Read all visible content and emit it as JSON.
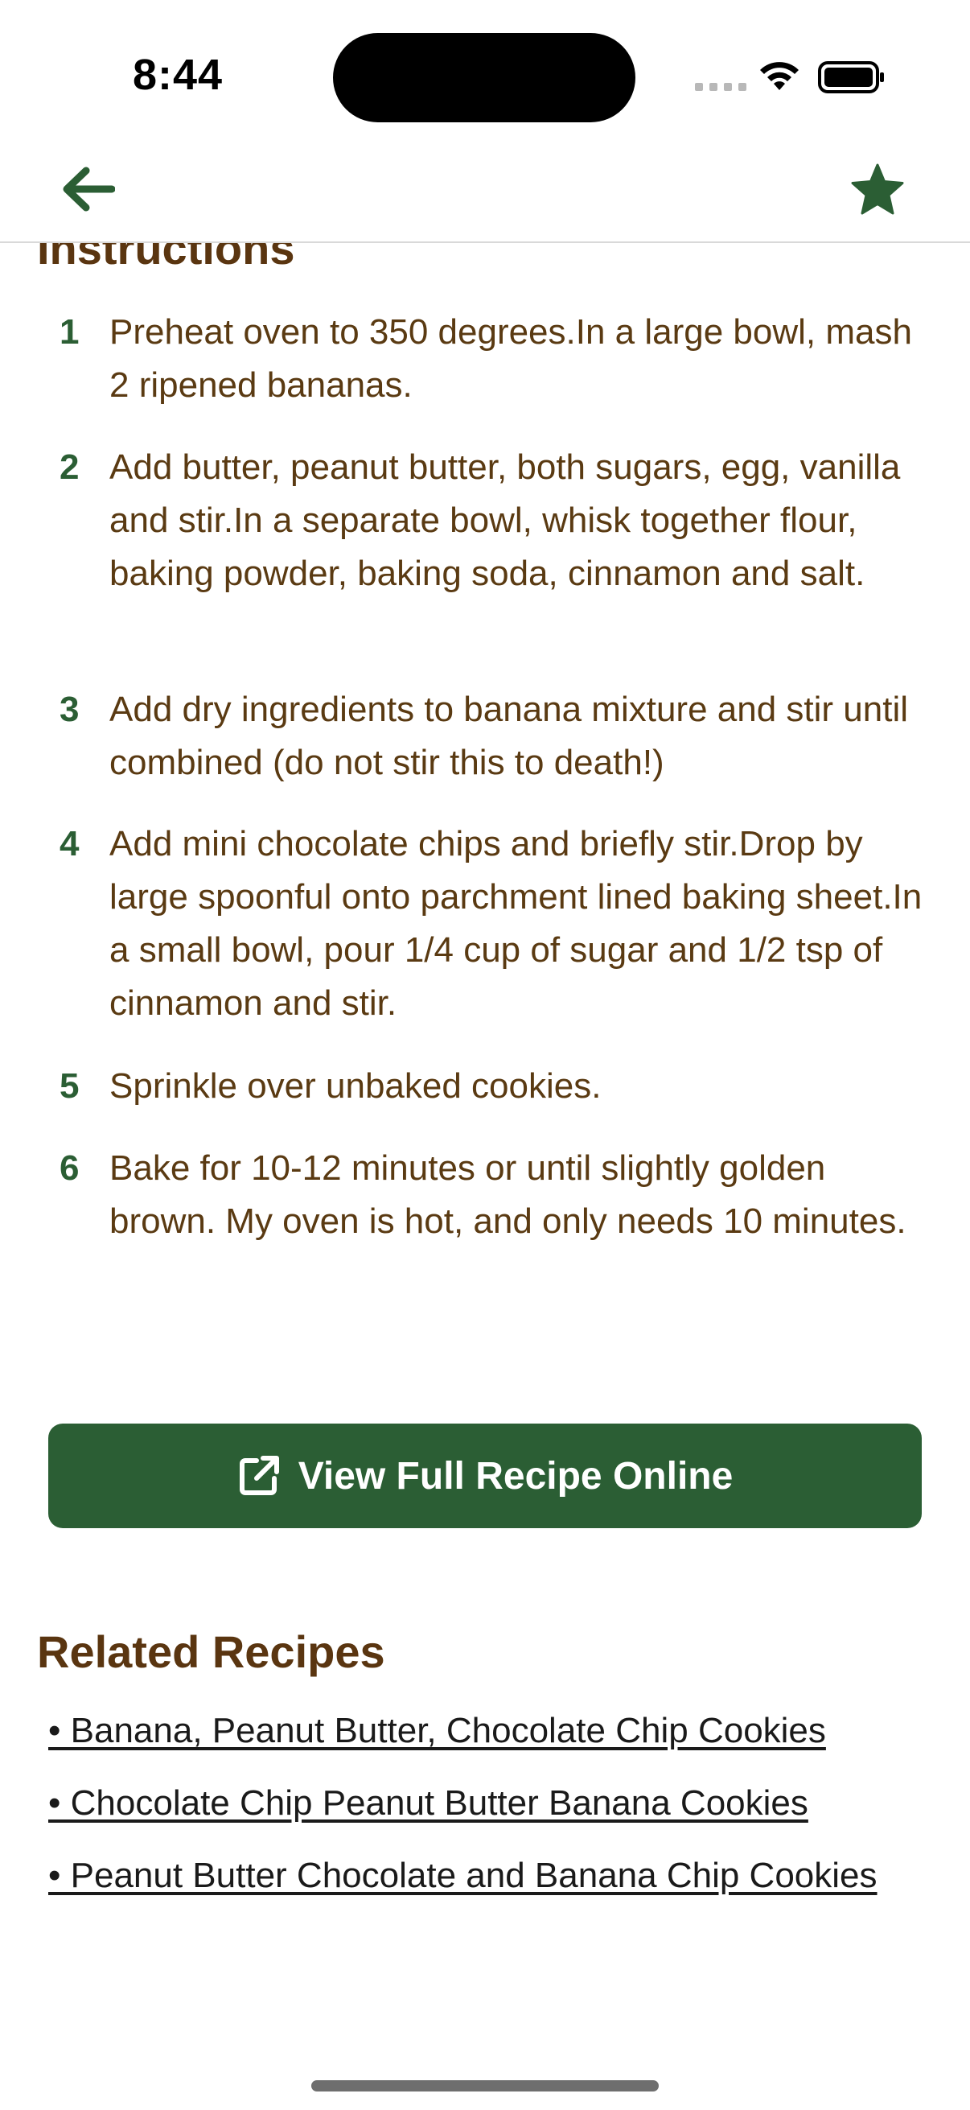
{
  "status_bar": {
    "time": "8:44"
  },
  "nav": {
    "back_icon": "arrow-left-icon",
    "favorite_icon": "star-icon"
  },
  "instructions": {
    "heading": "Instructions",
    "steps": [
      {
        "number": "1",
        "text": "Preheat oven to 350 degrees.In a large bowl, mash 2 ripened bananas."
      },
      {
        "number": "2",
        "text": "Add butter, peanut butter, both sugars, egg, vanilla and stir.In a separate bowl, whisk together flour, baking powder, baking soda, cinnamon and salt."
      },
      {
        "number": "3",
        "text": "Add dry ingredients to banana mixture and stir until combined (do not stir this to death!)"
      },
      {
        "number": "4",
        "text": "Add mini chocolate chips and briefly stir.Drop by large spoonful onto parchment lined baking sheet.In a small bowl, pour 1/4 cup of sugar and 1/2 tsp of cinnamon and stir."
      },
      {
        "number": "5",
        "text": "Sprinkle over unbaked cookies."
      },
      {
        "number": "6",
        "text": "Bake for 10-12 minutes or until slightly golden brown.  My oven is hot, and only needs 10 minutes."
      }
    ]
  },
  "view_button": {
    "label": "View Full Recipe Online",
    "icon": "external-link-icon"
  },
  "related": {
    "heading": "Related Recipes",
    "items": [
      "• Banana, Peanut Butter, Chocolate Chip Cookies",
      "• Chocolate Chip Peanut Butter Banana Cookies",
      "• Peanut Butter Chocolate and Banana Chip Cookies"
    ]
  },
  "colors": {
    "accent": "#2b5e34",
    "heading": "#5a3510",
    "body_text": "#5a3a12"
  }
}
